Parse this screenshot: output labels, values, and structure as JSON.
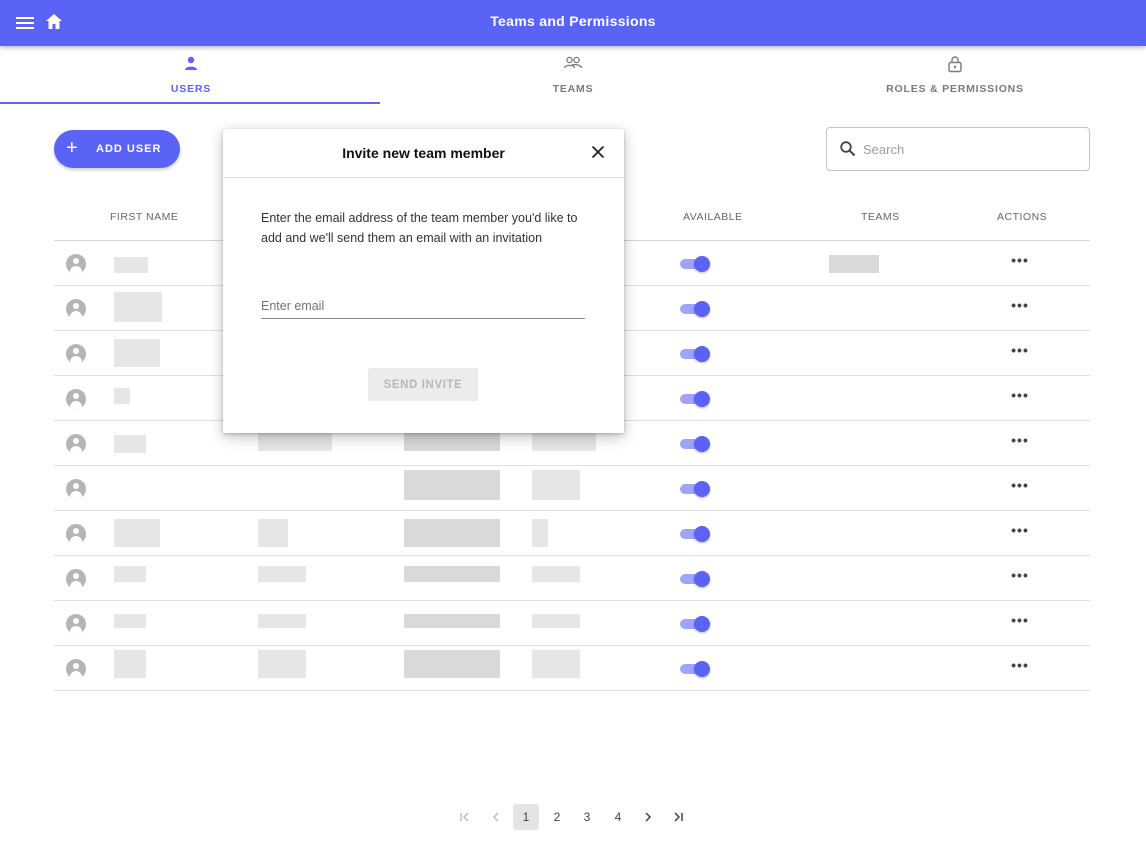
{
  "appbar": {
    "title": "Teams and Permissions",
    "menu_icon": "menu-icon",
    "home_icon": "home-icon",
    "color": "#5a63f5"
  },
  "tabs": [
    {
      "label": "USERS",
      "icon": "person-icon",
      "active": true
    },
    {
      "label": "TEAMS",
      "icon": "people-icon",
      "active": false
    },
    {
      "label": "ROLES & PERMISSIONS",
      "icon": "lock-icon",
      "active": false
    }
  ],
  "toolbar": {
    "add_user_label": "ADD USER",
    "search_placeholder": "Search"
  },
  "table": {
    "columns": [
      "FIRST NAME",
      "AVAILABLE",
      "TEAMS",
      "ACTIONS"
    ],
    "rows": [
      {
        "available": true,
        "action": "•••"
      },
      {
        "available": true,
        "action": "•••"
      },
      {
        "available": true,
        "action": "•••"
      },
      {
        "available": true,
        "action": "•••"
      },
      {
        "available": true,
        "action": "•••"
      },
      {
        "available": true,
        "action": "•••"
      },
      {
        "available": true,
        "action": "•••"
      },
      {
        "available": true,
        "action": "•••"
      },
      {
        "available": true,
        "action": "•••"
      },
      {
        "available": true,
        "action": "•••"
      }
    ]
  },
  "pagination": {
    "pages": [
      "1",
      "2",
      "3",
      "4"
    ],
    "current": "1"
  },
  "dialog": {
    "title": "Invite new team member",
    "description": "Enter the email address of the team member you'd like to add and we'll send them an email with an invitation",
    "email_placeholder": "Enter email",
    "send_label": "SEND INVITE"
  }
}
